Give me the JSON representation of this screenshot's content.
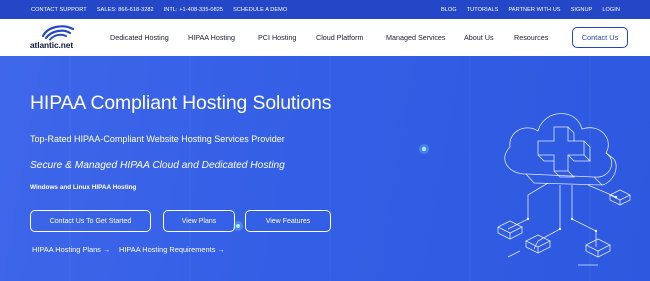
{
  "topbar": {
    "left": [
      "CONTACT SUPPORT",
      "SALES: 866-618-3282",
      "INTL: +1-408-335-0825",
      "SCHEDULE A DEMO"
    ],
    "right": [
      "BLOG",
      "TUTORIALS",
      "PARTNER WITH US",
      "SIGNUP",
      "LOGIN"
    ]
  },
  "logo": {
    "text": "atlantic.net"
  },
  "nav": {
    "items": [
      "Dedicated Hosting",
      "HIPAA Hosting",
      "PCI Hosting",
      "Cloud Platform",
      "Managed Services",
      "About Us",
      "Resources"
    ],
    "contact": "Contact Us"
  },
  "hero": {
    "title": "HIPAA Compliant Hosting Solutions",
    "subtitle": "Top-Rated HIPAA-Compliant Website Hosting Services Provider",
    "tagline": "Secure & Managed HIPAA Cloud and Dedicated Hosting",
    "note": "Windows and Linux HIPAA Hosting",
    "buttons": [
      "Contact Us To Get Started",
      "View Plans",
      "View Features"
    ],
    "links": [
      "HIPAA Hosting Plans →",
      "HIPAA Hosting Requirements →"
    ]
  },
  "colors": {
    "topbar": "#2447c7",
    "hero": "#3660e6",
    "accent": "#2447c7",
    "text_dark": "#1b1f2e"
  },
  "icons": [
    "logo-swirl-icon",
    "cloud-medical-cross-illustration"
  ]
}
